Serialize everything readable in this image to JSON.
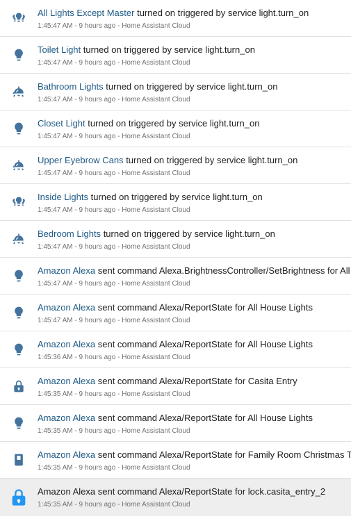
{
  "colors": {
    "icon": "#44739e",
    "icon_highlight": "#2196f3",
    "link": "#1f5a85",
    "text": "#212121",
    "secondary": "#727272",
    "divider": "#e1e1e1",
    "highlight_bg": "#eeeeee"
  },
  "entries": [
    {
      "icon": "lightbulb-group-icon",
      "name": "All Lights Except Master",
      "message": "turned on triggered by service light.turn_on",
      "time": "1:45:47 AM",
      "relative": "9 hours ago",
      "source": "Home Assistant Cloud"
    },
    {
      "icon": "lightbulb-icon",
      "name": "Toilet Light",
      "message": "turned on triggered by service light.turn_on",
      "time": "1:45:47 AM",
      "relative": "9 hours ago",
      "source": "Home Assistant Cloud"
    },
    {
      "icon": "ceiling-light-icon",
      "name": "Bathroom Lights",
      "message": "turned on triggered by service light.turn_on",
      "time": "1:45:47 AM",
      "relative": "9 hours ago",
      "source": "Home Assistant Cloud"
    },
    {
      "icon": "lightbulb-icon",
      "name": "Closet Light",
      "message": "turned on triggered by service light.turn_on",
      "time": "1:45:47 AM",
      "relative": "9 hours ago",
      "source": "Home Assistant Cloud"
    },
    {
      "icon": "ceiling-light-icon",
      "name": "Upper Eyebrow Cans",
      "message": "turned on triggered by service light.turn_on",
      "time": "1:45:47 AM",
      "relative": "9 hours ago",
      "source": "Home Assistant Cloud"
    },
    {
      "icon": "lightbulb-group-icon",
      "name": "Inside Lights",
      "message": "turned on triggered by service light.turn_on",
      "time": "1:45:47 AM",
      "relative": "9 hours ago",
      "source": "Home Assistant Cloud"
    },
    {
      "icon": "ceiling-light-icon",
      "name": "Bedroom Lights",
      "message": "turned on triggered by service light.turn_on",
      "time": "1:45:47 AM",
      "relative": "9 hours ago",
      "source": "Home Assistant Cloud"
    },
    {
      "icon": "lightbulb-icon",
      "name": "Amazon Alexa",
      "message": "sent command Alexa.BrightnessController/SetBrightness for All House Lights",
      "time": "1:45:47 AM",
      "relative": "9 hours ago",
      "source": "Home Assistant Cloud"
    },
    {
      "icon": "lightbulb-icon",
      "name": "Amazon Alexa",
      "message": "sent command Alexa/ReportState for All House Lights",
      "time": "1:45:47 AM",
      "relative": "9 hours ago",
      "source": "Home Assistant Cloud"
    },
    {
      "icon": "lightbulb-icon",
      "name": "Amazon Alexa",
      "message": "sent command Alexa/ReportState for All House Lights",
      "time": "1:45:36 AM",
      "relative": "9 hours ago",
      "source": "Home Assistant Cloud"
    },
    {
      "icon": "lock-icon",
      "name": "Amazon Alexa",
      "message": "sent command Alexa/ReportState for Casita Entry",
      "time": "1:45:35 AM",
      "relative": "9 hours ago",
      "source": "Home Assistant Cloud"
    },
    {
      "icon": "lightbulb-icon",
      "name": "Amazon Alexa",
      "message": "sent command Alexa/ReportState for All House Lights",
      "time": "1:45:35 AM",
      "relative": "9 hours ago",
      "source": "Home Assistant Cloud"
    },
    {
      "icon": "switch-icon",
      "name": "Amazon Alexa",
      "message": "sent command Alexa/ReportState for Family Room Christmas Tree",
      "time": "1:45:35 AM",
      "relative": "9 hours ago",
      "source": "Home Assistant Cloud"
    },
    {
      "icon": "lock-icon",
      "name": "Amazon Alexa",
      "message": "sent command Alexa/ReportState for lock.casita_entry_2",
      "time": "1:45:35 AM",
      "relative": "9 hours ago",
      "source": "Home Assistant Cloud",
      "highlight": true
    }
  ]
}
